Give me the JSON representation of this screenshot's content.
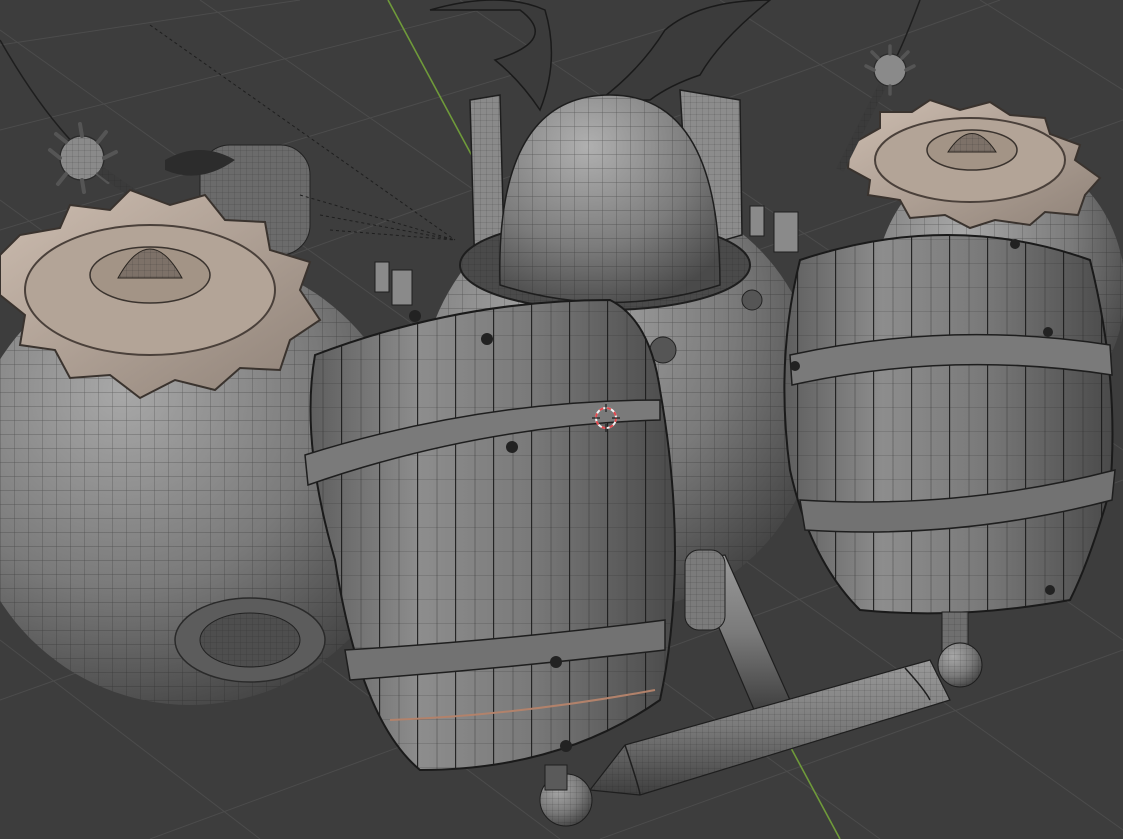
{
  "viewport": {
    "name": "3D Viewport",
    "shading": "solid-wireframe-overlay",
    "colors": {
      "background": "#3d3d3d",
      "grid_line": "#4a4a4a",
      "axis_y": "#6f9a3a",
      "model_light": "#9a9a9a",
      "model_mid": "#6f6f6f",
      "model_dark": "#3a3a3a",
      "gear_top": "#b7a89c",
      "wire": "#1e1e1e",
      "cursor_red": "#e0484d",
      "cursor_white": "#f2f2f2"
    }
  },
  "scene": {
    "objects": [
      {
        "name": "left-balloon-sphere"
      },
      {
        "name": "left-gear"
      },
      {
        "name": "left-spiked-mine"
      },
      {
        "name": "center-dome"
      },
      {
        "name": "center-cockpit-canopy"
      },
      {
        "name": "center-wing-sail"
      },
      {
        "name": "center-body-sphere"
      },
      {
        "name": "front-barrel"
      },
      {
        "name": "right-barrel"
      },
      {
        "name": "right-gear"
      },
      {
        "name": "right-spiked-mine"
      },
      {
        "name": "right-balloon-sphere"
      },
      {
        "name": "landing-strut-front"
      },
      {
        "name": "landing-axle"
      },
      {
        "name": "landing-joint-left"
      },
      {
        "name": "landing-joint-right"
      }
    ]
  }
}
